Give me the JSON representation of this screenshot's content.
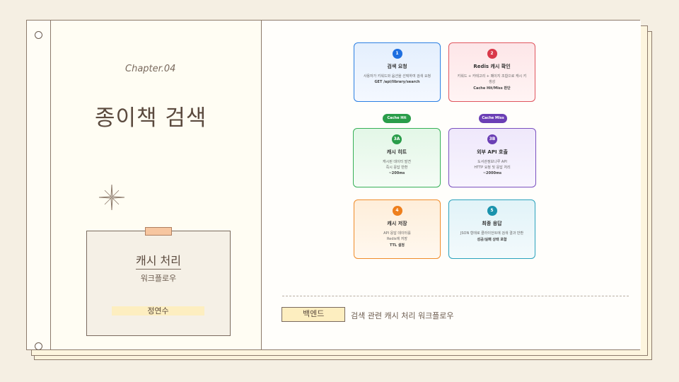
{
  "left": {
    "chapter": "Chapter.04",
    "title": "종이책 검색",
    "card": {
      "title": "캐시 처리",
      "subtitle": "워크플로우",
      "author": "정연수"
    }
  },
  "steps": [
    {
      "num": "1",
      "title": "검색 요청",
      "desc": "사용자가 키워드와 옵션을 선택하여 검색 요청",
      "meta": "GET /api/library/search",
      "color": "#2b7fe3"
    },
    {
      "num": "2",
      "title": "Redis 캐시 확인",
      "desc": "키워드 + 카테고리 + 페이지 조합으로 캐시 키 생성",
      "meta": "Cache Hit/Miss 판단",
      "color": "#e0555e"
    },
    {
      "num": "3A",
      "title": "캐시 히트",
      "desc": "캐시된 데이터 발견\n즉시 응답 반환",
      "meta": "~200ms",
      "color": "#36b057"
    },
    {
      "num": "3B",
      "title": "외부 API 호출",
      "desc": "도서관정보나루 API\nHTTP 요청 및 응답 처리",
      "meta": "~2000ms",
      "color": "#7a50c0"
    },
    {
      "num": "4",
      "title": "캐시 저장",
      "desc": "API 응답 데이터를\nRedis에 저장",
      "meta": "TTL 설정",
      "color": "#f08c2a"
    },
    {
      "num": "5",
      "title": "최종 응답",
      "desc": "JSON 형태로 클라이언트에 검색 결과 반환",
      "meta": "성공/실패 상태 포함",
      "color": "#2aa2bd"
    }
  ],
  "pills": {
    "hit": "Cache Hit",
    "miss": "Cache Miss"
  },
  "footer": {
    "tag": "백엔드",
    "description": "검색 관련 캐시 처리 워크플로우"
  }
}
